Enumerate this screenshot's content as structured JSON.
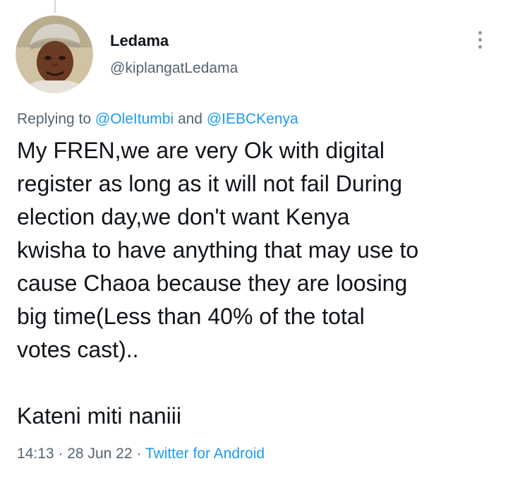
{
  "author": {
    "display_name": "Ledama",
    "handle": "@kiplangatLedama"
  },
  "reply_context": {
    "prefix": "Replying to",
    "mention_1": "@OleItumbi",
    "conjunction": "and",
    "mention_2": "@IEBCKenya"
  },
  "tweet": {
    "lines": [
      "My FREN,we are very Ok with digital",
      "register as long as it will not fail During",
      "election day,we don't want Kenya",
      "kwisha to have anything that may use to",
      "cause Chaoa because they are loosing",
      "big time(Less than 40% of the total",
      "votes cast).."
    ],
    "closing": "Kateni miti naniii"
  },
  "meta": {
    "time": "14:13",
    "separator": "·",
    "date": "28 Jun 22",
    "source": "Twitter for Android"
  },
  "icons": {
    "more": "more-vertical-icon"
  },
  "colors": {
    "text": "#0f1419",
    "secondary": "#536471",
    "link": "#1d9bf0"
  }
}
